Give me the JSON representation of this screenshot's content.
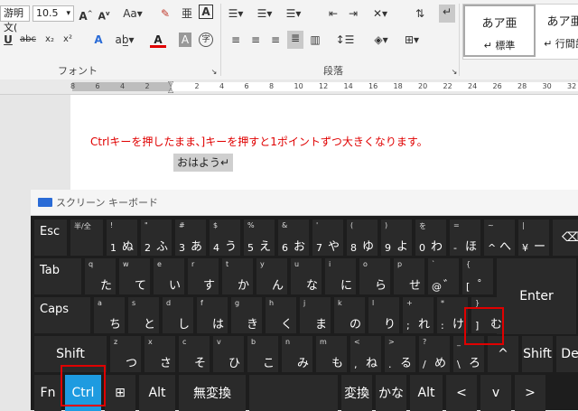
{
  "ribbon": {
    "font_name": "游明文(",
    "font_size": "10.5",
    "font_group_label": "フォント",
    "para_group_label": "段落",
    "styles": [
      {
        "sample": "あア亜",
        "name": "標準"
      },
      {
        "sample": "あア亜",
        "name": "行間詰"
      }
    ]
  },
  "ruler": {
    "numbers": [
      "8",
      "6",
      "4",
      "2",
      "",
      "2",
      "4",
      "6",
      "8",
      "10",
      "12",
      "14",
      "16",
      "18",
      "20",
      "22",
      "24",
      "26",
      "28",
      "30",
      "32"
    ]
  },
  "document": {
    "instruction": "Ctrlキーを押したまま、]キーを押すと1ポイントずつ大きくなります。",
    "selected_text": "おはよう↵"
  },
  "osk": {
    "title": "スクリーン キーボード",
    "rows": [
      [
        {
          "l": "Esc"
        },
        {
          "tl": "半/全"
        },
        {
          "tl": "!",
          "bl": "1",
          "br": "ぬ"
        },
        {
          "tl": "\"",
          "bl": "2",
          "br": "ふ"
        },
        {
          "tl": "#",
          "bl": "3",
          "br": "あ"
        },
        {
          "tl": "$",
          "bl": "4",
          "br": "う"
        },
        {
          "tl": "%",
          "bl": "5",
          "br": "え"
        },
        {
          "tl": "&",
          "bl": "6",
          "br": "お"
        },
        {
          "tl": "'",
          "bl": "7",
          "br": "や"
        },
        {
          "tl": "(",
          "bl": "8",
          "br": "ゆ"
        },
        {
          "tl": ")",
          "bl": "9",
          "br": "よ"
        },
        {
          "tl": "を",
          "bl": "0",
          "br": "わ"
        },
        {
          "tl": "=",
          "bl": "-",
          "br": "ほ"
        },
        {
          "tl": "~",
          "bl": "^",
          "br": "へ"
        },
        {
          "tl": "|",
          "bl": "¥",
          "br": "ー"
        },
        {
          "c": "⌫"
        }
      ],
      [
        {
          "l": "Tab"
        },
        {
          "tl": "q",
          "br": "た"
        },
        {
          "tl": "w",
          "br": "て"
        },
        {
          "tl": "e",
          "br": "い"
        },
        {
          "tl": "r",
          "br": "す"
        },
        {
          "tl": "t",
          "br": "か"
        },
        {
          "tl": "y",
          "br": "ん"
        },
        {
          "tl": "u",
          "br": "な"
        },
        {
          "tl": "i",
          "br": "に"
        },
        {
          "tl": "o",
          "br": "ら"
        },
        {
          "tl": "p",
          "br": "せ"
        },
        {
          "tl": "`",
          "bl": "@",
          "br": "゛"
        },
        {
          "tl": "{",
          "bl": "[",
          "br": "゜"
        },
        {
          "c": "Enter"
        }
      ],
      [
        {
          "l": "Caps"
        },
        {
          "tl": "a",
          "br": "ち"
        },
        {
          "tl": "s",
          "br": "と"
        },
        {
          "tl": "d",
          "br": "し"
        },
        {
          "tl": "f",
          "br": "は"
        },
        {
          "tl": "g",
          "br": "き"
        },
        {
          "tl": "h",
          "br": "く"
        },
        {
          "tl": "j",
          "br": "ま"
        },
        {
          "tl": "k",
          "br": "の"
        },
        {
          "tl": "l",
          "br": "り"
        },
        {
          "tl": "+",
          "bl": ";",
          "br": "れ"
        },
        {
          "tl": "*",
          "bl": ":",
          "br": "け"
        },
        {
          "tl": "}",
          "bl": "]",
          "br": "む"
        }
      ],
      [
        {
          "c": "Shift"
        },
        {
          "tl": "z",
          "br": "つ"
        },
        {
          "tl": "x",
          "br": "さ"
        },
        {
          "tl": "c",
          "br": "そ"
        },
        {
          "tl": "v",
          "br": "ひ"
        },
        {
          "tl": "b",
          "br": "こ"
        },
        {
          "tl": "n",
          "br": "み"
        },
        {
          "tl": "m",
          "br": "も"
        },
        {
          "tl": "<",
          "bl": ",",
          "br": "ね"
        },
        {
          "tl": ">",
          "bl": ".",
          "br": "る"
        },
        {
          "tl": "?",
          "bl": "/",
          "br": "め"
        },
        {
          "tl": "_",
          "bl": "\\",
          "br": "ろ"
        },
        {
          "c": "^"
        },
        {
          "c": "Shift"
        },
        {
          "c": "De"
        }
      ],
      [
        {
          "c": "Fn"
        },
        {
          "c": "Ctrl"
        },
        {
          "c": "⊞"
        },
        {
          "c": "Alt"
        },
        {
          "c": "無変換"
        },
        {
          "c": ""
        },
        {
          "c": "変換"
        },
        {
          "c": "かな"
        },
        {
          "c": "Alt"
        },
        {
          "c": "<"
        },
        {
          "c": "v"
        },
        {
          "c": ">"
        }
      ]
    ]
  },
  "colors": {
    "ctrl_key": "#1e9be0",
    "highlight": "#e00000",
    "instruction_text": "#e00000"
  }
}
